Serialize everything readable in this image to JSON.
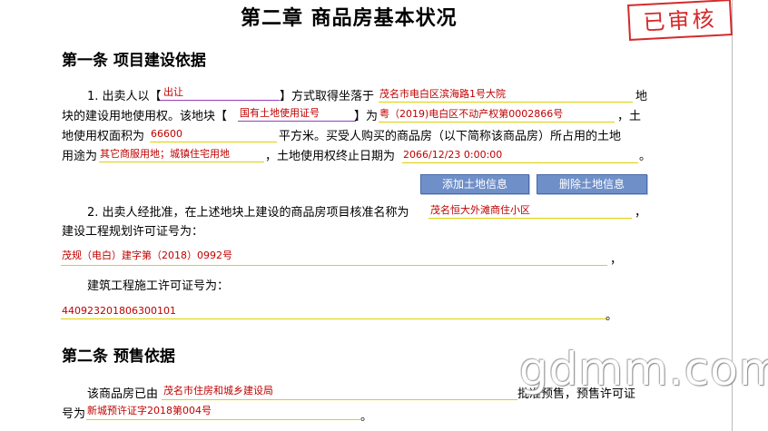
{
  "chapter_title": "第二章  商品房基本状况",
  "stamp_text": "已审核",
  "article1": {
    "heading": "第一条  项目建设依据",
    "p1_text1": "1. 出卖人以【",
    "p1_text2": "】方式取得坐落于",
    "p1_text3": "地",
    "p1_text4": "块的建设用地使用权。该地块【",
    "p1_text5": "】为",
    "p1_text6": "，土",
    "p1_text7": "地使用权面积为",
    "p1_text8": "平方米。买受人购买的商品房（以下简称该商品房）所占用的土地",
    "p1_text9": "用途为",
    "p1_text10": "，土地使用权终止日期为",
    "p1_text11": "。",
    "acquire_method": "出让",
    "location": "茂名市电白区滨海路1号大院",
    "cert_type": "国有土地使用证号",
    "cert_number": "粤（2019)电白区不动产权第0002866号",
    "land_area": "66600",
    "land_use": "其它商服用地；城镇住宅用地",
    "end_date": "2066/12/23 0:00:00",
    "add_button": "添加土地信息",
    "delete_button": "删除土地信息",
    "p2_text1": "2. 出卖人经批准，在上述地块上建设的商品房项目核准名称为",
    "p2_text2": "，",
    "p2_text3": "建设工程规划许可证号为：",
    "p2_text4": "，",
    "p2_text5": "建筑工程施工许可证号为：",
    "p2_text6": "。",
    "project_name": "茂名恒大外滩商住小区",
    "planning_permit": "茂规（电白）建字第（2018）0992号",
    "construction_permit": "440923201806300101"
  },
  "article2": {
    "heading": "第二条  预售依据",
    "p_text1": "该商品房已由",
    "p_text2": "批准预售，预售许可证",
    "p_text3": "号为",
    "p_text4": "。",
    "authority": "茂名市住房和城乡建设局",
    "presale_permit": "新城预许证字2018第004号"
  },
  "watermark_text": "gdmm.com"
}
